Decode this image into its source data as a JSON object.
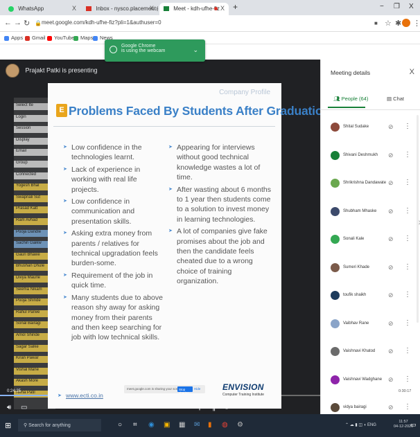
{
  "browser": {
    "tabs": [
      {
        "label": "WhatsApp",
        "close": "X",
        "icon_color": "#25d366"
      },
      {
        "label": "Inbox - nysco.placement@gmai",
        "close": "X",
        "icon_color": "#d93025"
      },
      {
        "label": "Meet - kdh-ufhe-fiz",
        "close": "X",
        "icon_color": "#188038"
      }
    ],
    "new_tab": "+",
    "window_controls": [
      "−",
      "❐",
      "X"
    ],
    "url": "meet.google.com/kdh-ufhe-fiz?pli=1&authuser=0",
    "bookmarks": [
      {
        "label": "Apps",
        "color": "#4285f4"
      },
      {
        "label": "Gmail",
        "color": "#d93025"
      },
      {
        "label": "YouTube",
        "color": "#ff0000"
      },
      {
        "label": "Maps",
        "color": "#34a853"
      },
      {
        "label": "News",
        "color": "#4285f4"
      }
    ],
    "notification": {
      "line1": "Google Chrome",
      "line2": "is using the webcam"
    }
  },
  "meet": {
    "presenter": "Prajakt Patki is presenting",
    "elapsed": "0:24:25",
    "progress_fraction": 0.39,
    "panel": {
      "title": "Meeting details",
      "close": "X",
      "tab_people": "People (64)",
      "tab_chat": "Chat",
      "people": [
        {
          "name": "Shital Sudake",
          "color": "#8d4a3b"
        },
        {
          "name": "Shivani Deshmukh",
          "color": "#188038"
        },
        {
          "name": "Shrikrishna Dandawate",
          "color": "#6aa84f"
        },
        {
          "name": "Shubham Mhaske",
          "color": "#3c4a6b"
        },
        {
          "name": "Sonali Kale",
          "color": "#34a853"
        },
        {
          "name": "Sumeri Khade",
          "color": "#7b5b4a"
        },
        {
          "name": "toufik shaikh",
          "color": "#1d3b5c"
        },
        {
          "name": "Vaibhav Rane",
          "color": "#8aa4c8"
        },
        {
          "name": "Vaishnavi Khatod",
          "color": "#6b6b6b"
        },
        {
          "name": "Vaishnavi Wadghane",
          "color": "#8e24aa"
        },
        {
          "name": "vidya bairagi",
          "color": "#5b4a3a"
        }
      ],
      "time": "0:30:17"
    }
  },
  "slide": {
    "tag": "Company Profile",
    "logo_letter": "E",
    "title": "Problems Faced By Students After Graduation",
    "left_items": [
      "Low confidence in the technologies learnt.",
      "Lack of experience in working with real life projects.",
      "Low confidence in communication and presentation skills.",
      "Asking extra money from parents / relatives for technical upgradation feels burden-some.",
      "Requirement of the job in quick time.",
      "Many students due to above reason shy away for asking money from their parents and then keep searching for job with low technical skills."
    ],
    "right_items": [
      "Appearing for interviews without good technical knowledge wastes a lot of time.",
      "After wasting about 6 months to 1 year then students come to a solution to invest money in learning technologies.",
      "A lot of companies give fake promises about the job and then the candidate feels cheated due to a wrong choice of training organization."
    ],
    "url": "www.ecti.co.in",
    "brand_name": "ENVISION",
    "brand_sub": "Computer Training Institute"
  },
  "share_bar": {
    "text": "meet.google.com is sharing your screen.",
    "stop": "Stop sharing",
    "hide": "Hide"
  },
  "ghost_sheet": {
    "rows": [
      "Select Ite",
      "Login",
      "Session",
      "Display",
      "Email",
      "Group",
      "Connected",
      "Yogesh Bhal",
      "Swapnali Sut",
      "Prasad Katt",
      "Ram Avhad",
      "Pooja Dandle",
      "Sachin Gaikw",
      "Gauri Bhawe",
      "Bhushan Dhule",
      "Divya Maurle",
      "Seema Nikam",
      "Pooja Shinde",
      "Rahul Parwe",
      "Sonal Bairagi",
      "Amol Shinde",
      "Sagar Salke",
      "Kiran Pawar",
      "Vishal Mane",
      "Akash More",
      "Neha Patil"
    ]
  },
  "taskbar": {
    "search_placeholder": "Search for anything",
    "tray": "ENG",
    "clock_time": "11:57",
    "clock_date": "04-12-2020"
  }
}
